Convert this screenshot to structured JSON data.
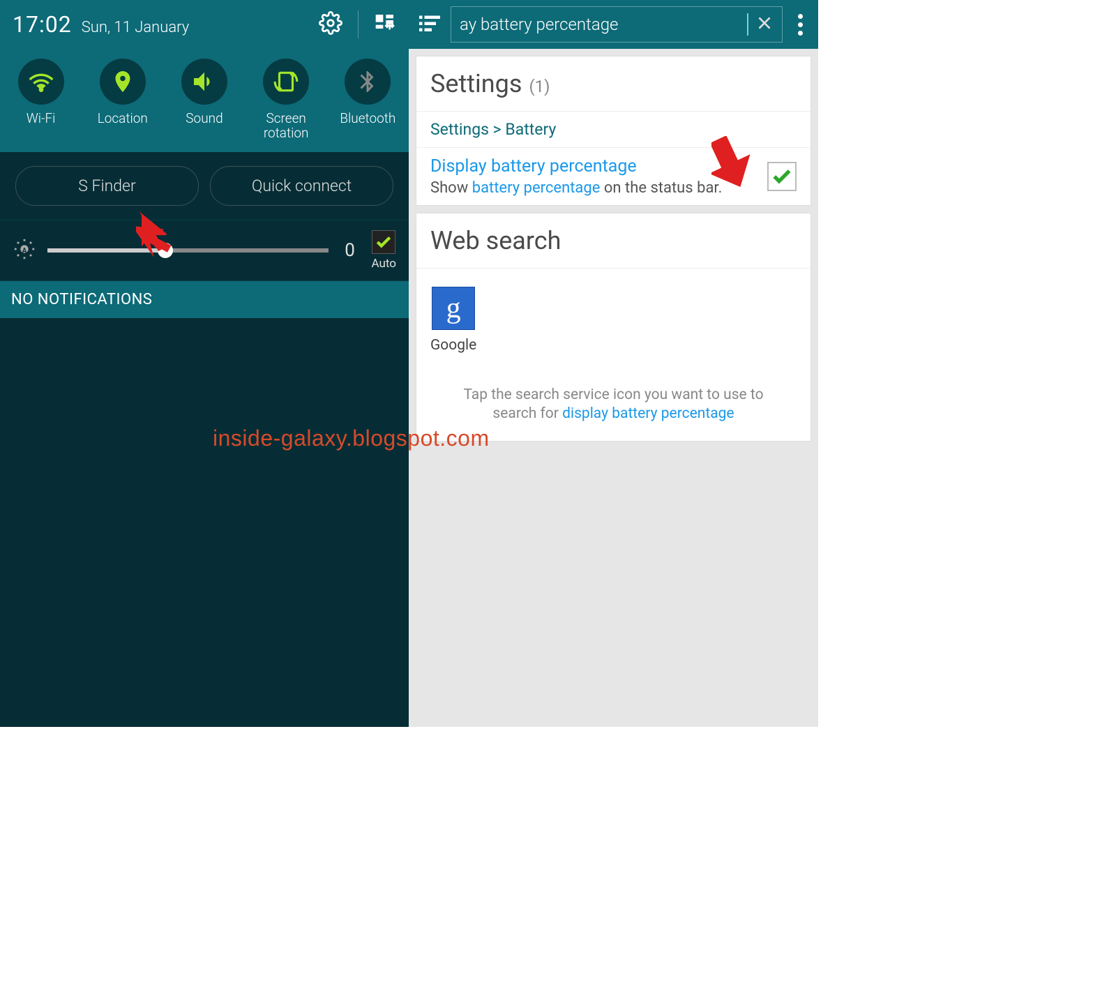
{
  "status": {
    "time": "17:02",
    "date": "Sun, 11 January"
  },
  "toggles": [
    {
      "label": "Wi-Fi"
    },
    {
      "label": "Location"
    },
    {
      "label": "Sound"
    },
    {
      "label": "Screen rotation"
    },
    {
      "label": "Bluetooth"
    }
  ],
  "actions": {
    "sfinder": "S Finder",
    "quickconnect": "Quick connect"
  },
  "brightness": {
    "value": "0",
    "auto_label": "Auto",
    "auto_checked": true
  },
  "no_notifications": "NO NOTIFICATIONS",
  "search": {
    "query": "ay battery percentage"
  },
  "settings_card": {
    "title": "Settings",
    "count": "(1)",
    "breadcrumb": "Settings > Battery",
    "result_title": "Display battery percentage",
    "result_desc_pre": "Show ",
    "result_desc_hl": "battery percentage",
    "result_desc_post": " on the status bar."
  },
  "websearch_card": {
    "title": "Web search",
    "google_label": "Google",
    "google_letter": "g",
    "tip_pre": "Tap the search service icon you want to use to search for ",
    "tip_hl": "display battery percentage"
  },
  "watermark": "inside-galaxy.blogspot.com"
}
